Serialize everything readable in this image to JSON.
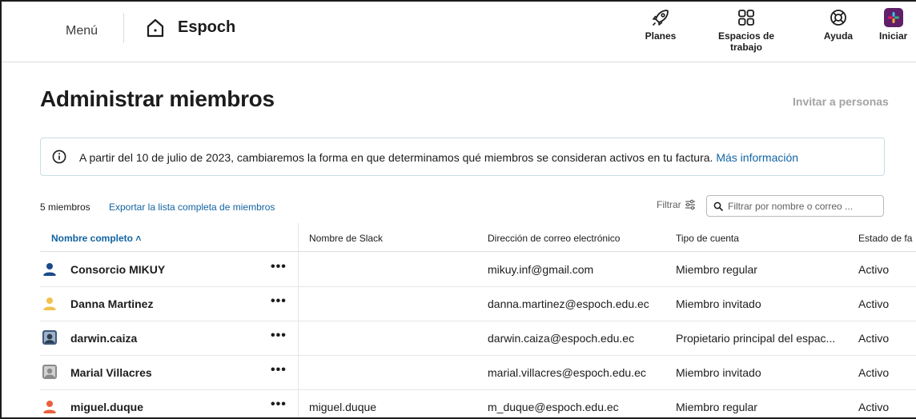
{
  "nav": {
    "menu": "Menú",
    "workspace": "Espoch",
    "items": [
      {
        "label": "Planes",
        "icon": "rocket-icon"
      },
      {
        "label": "Espacios de trabajo",
        "icon": "grid-icon"
      },
      {
        "label": "Ayuda",
        "icon": "lifebuoy-icon"
      },
      {
        "label": "Iniciar",
        "icon": "slack-logo"
      }
    ]
  },
  "page": {
    "title": "Administrar miembros",
    "invite": "Invitar a personas"
  },
  "banner": {
    "text": "A partir del 10 de julio de 2023, cambiaremos la forma en que determinamos qué miembros se consideran activos en tu factura.",
    "link": "Más información"
  },
  "toolbar": {
    "count": "5 miembros",
    "export": "Exportar la lista completa de miembros",
    "filter": "Filtrar",
    "search_placeholder": "Filtrar por nombre o correo ..."
  },
  "table": {
    "headers": {
      "name": "Nombre completo",
      "slack": "Nombre de Slack",
      "email": "Dirección de correo electrónico",
      "type": "Tipo de cuenta",
      "status": "Estado de fa"
    },
    "rows": [
      {
        "name": "Consorcio MIKUY",
        "slack": "",
        "email": "mikuy.inf@gmail.com",
        "type": "Miembro regular",
        "status": "Activo",
        "avatar": "user-blue-icon"
      },
      {
        "name": "Danna Martinez",
        "slack": "",
        "email": "danna.martinez@espoch.edu.ec",
        "type": "Miembro invitado",
        "status": "Activo",
        "avatar": "user-yellow-icon"
      },
      {
        "name": "darwin.caiza",
        "slack": "",
        "email": "darwin.caiza@espoch.edu.ec",
        "type": "Propietario principal del espac...",
        "status": "Activo",
        "avatar": "photo-avatar"
      },
      {
        "name": "Marial Villacres",
        "slack": "",
        "email": "marial.villacres@espoch.edu.ec",
        "type": "Miembro invitado",
        "status": "Activo",
        "avatar": "user-grey-icon"
      },
      {
        "name": "miguel.duque",
        "slack": "miguel.duque",
        "email": "m_duque@espoch.edu.ec",
        "type": "Miembro regular",
        "status": "Activo",
        "avatar": "user-red-icon"
      }
    ]
  },
  "colors": {
    "link": "#1264a3",
    "text": "#1d1c1d",
    "muted": "#a3a3a3",
    "banner_border": "#c8dde3",
    "slack_purple": "#611f69"
  }
}
